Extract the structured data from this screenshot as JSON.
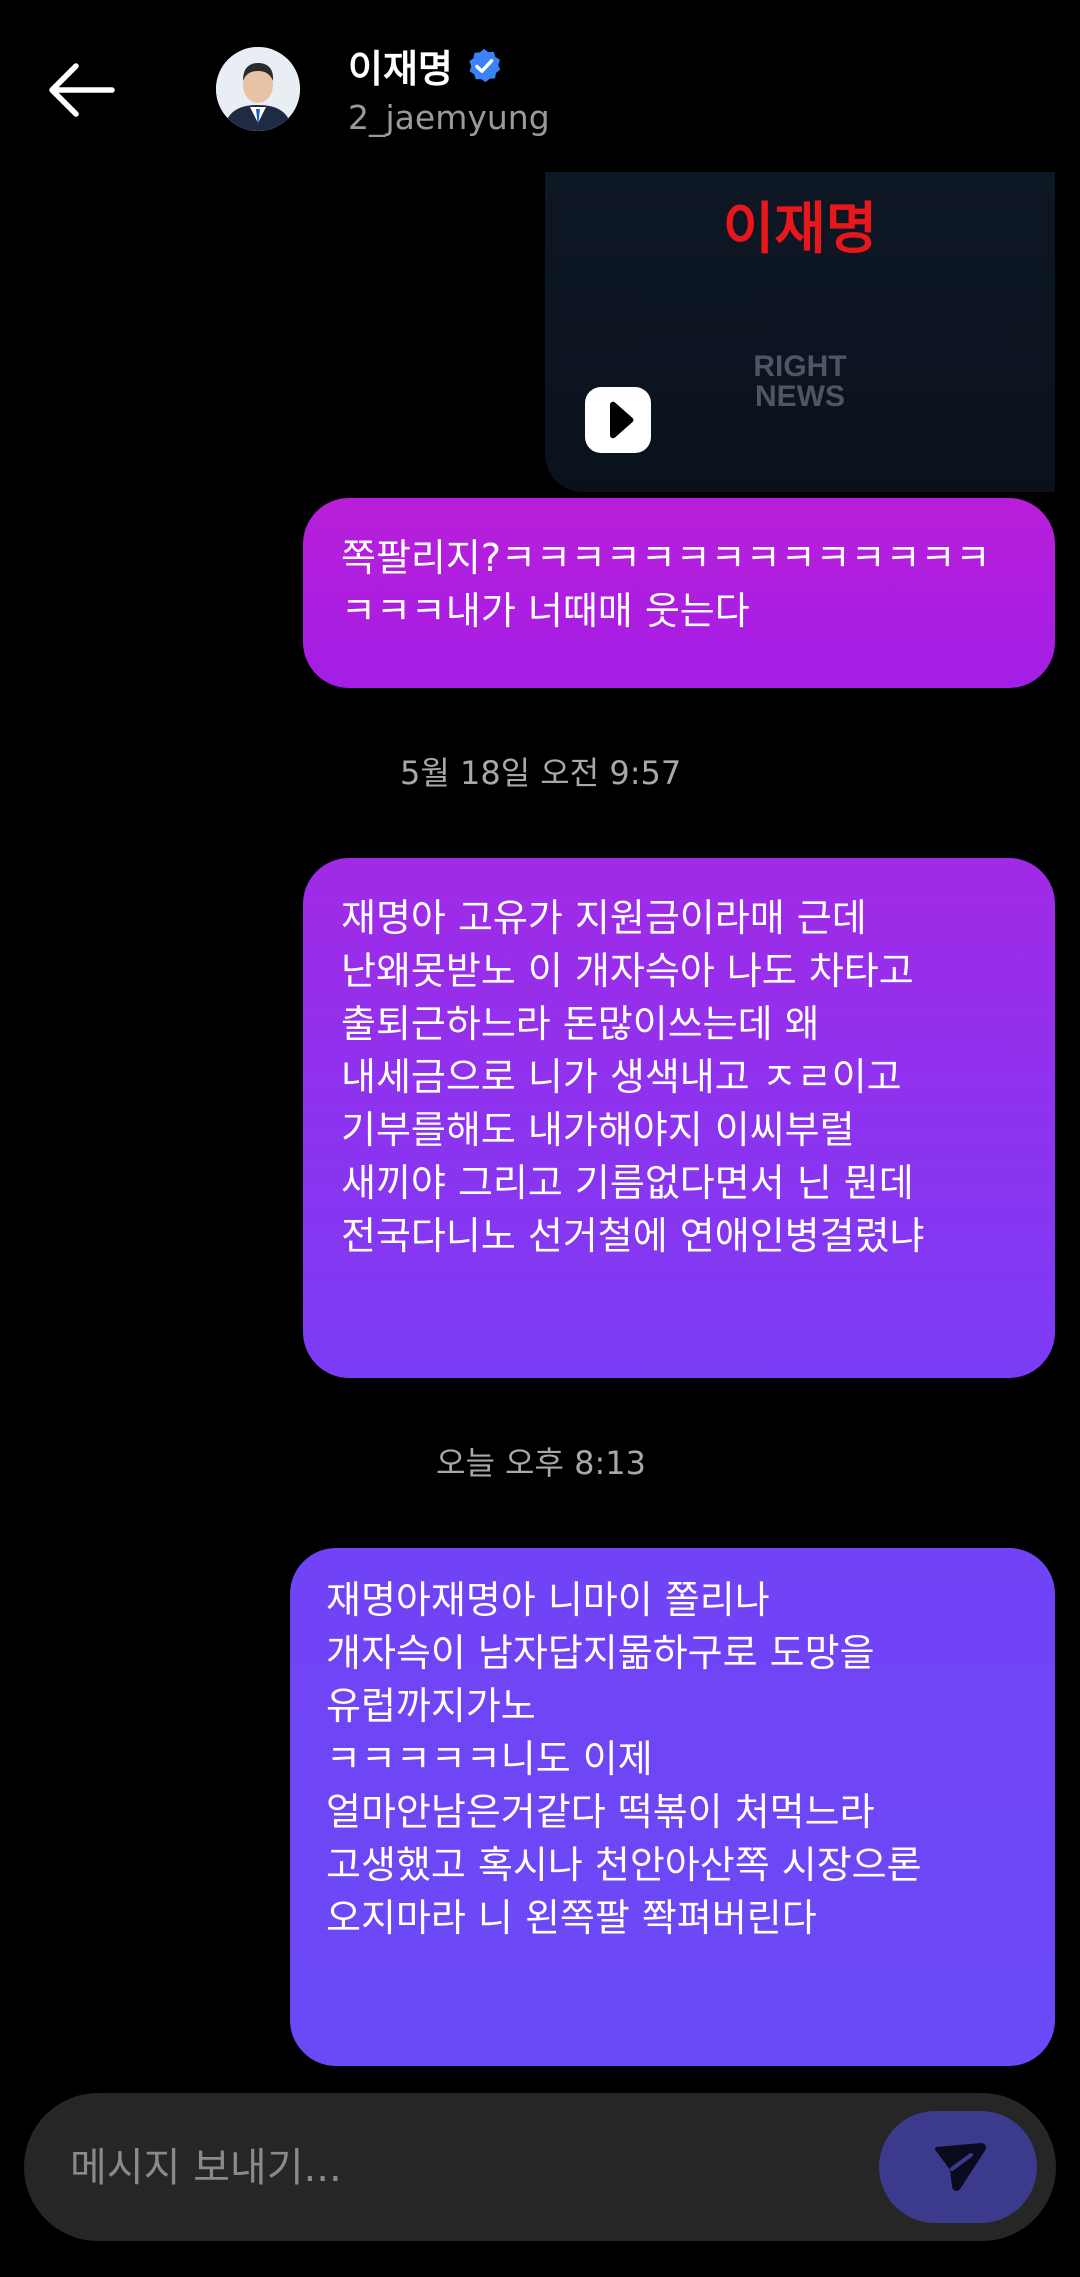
{
  "header": {
    "back_icon": "arrow-left-icon",
    "name": "이재명",
    "handle": "2_jaemyung",
    "verified_icon": "verified-badge-icon",
    "verified_color": "#3b82f6"
  },
  "video": {
    "title_text": "이재명",
    "watermark_line1": "RIGHT",
    "watermark_line2": "NEWS",
    "play_icon": "play-icon"
  },
  "messages": [
    {
      "lines": [
        "쪽팔리지?ㅋㅋㅋㅋㅋㅋㅋㅋㅋㅋㅋㅋㅋㅋ",
        "ㅋㅋㅋ내가 너때매 웃는다"
      ]
    },
    {
      "lines": [
        "재명아 고유가 지원금이라매 근데",
        "난왜못받노 이 개자슥아 나도 차타고",
        "출퇴근하느라 돈많이쓰는데 왜",
        "내세금으로 니가 생색내고 ㅈㄹ이고",
        "기부를해도 내가해야지 이씨부럴",
        "새끼야 그리고 기름없다면서 닌 뭔데",
        "전국다니노 선거철에 연애인병걸렸냐"
      ]
    },
    {
      "lines": [
        "재명아재명아 니마이 쫄리나",
        "개자슥이 남자답지몲하구로 도망을",
        "유럽까지가노",
        "ㅋㅋㅋㅋㅋ니도 이제",
        "얼마안남은거같다 떡볶이 처먹느라",
        "고생했고 혹시나 천안아산쪽 시장으론",
        "오지마라 니 왼쪽팔 쫙펴버린다"
      ]
    }
  ],
  "timestamps": {
    "ts1": "5월 18일 오전 9:57",
    "ts2": "오늘 오후 8:13"
  },
  "composer": {
    "placeholder": "메시지 보내기...",
    "send_icon": "send-icon"
  },
  "colors": {
    "background": "#000000",
    "bubble_1": "#b91fd9",
    "bubble_2": "#8d33ef",
    "bubble_3": "#6a4af7",
    "send_button": "#3c3a8c"
  }
}
